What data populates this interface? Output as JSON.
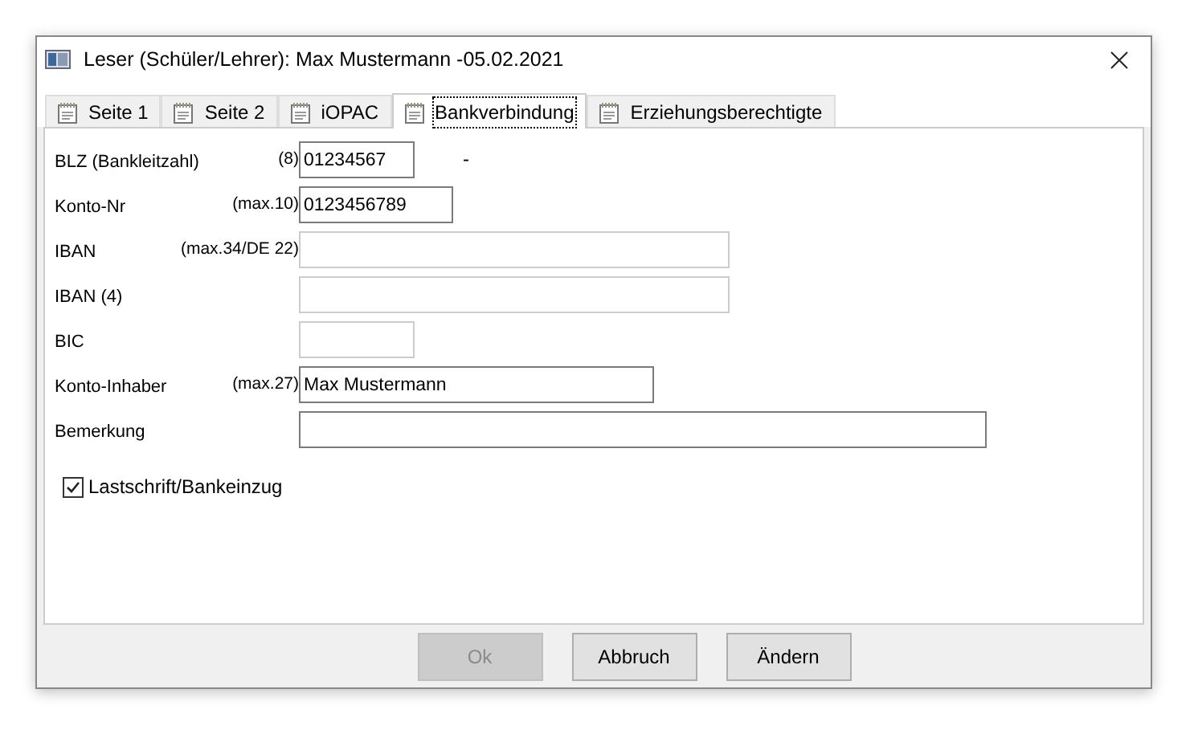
{
  "window": {
    "title": "Leser (Schüler/Lehrer): Max Mustermann -05.02.2021"
  },
  "tabs": [
    {
      "label": "Seite 1",
      "selected": false
    },
    {
      "label": "Seite 2",
      "selected": false
    },
    {
      "label": "iOPAC",
      "selected": false
    },
    {
      "label": "Bankverbindung",
      "selected": true
    },
    {
      "label": "Erziehungsberechtigte",
      "selected": false
    }
  ],
  "fields": [
    {
      "label": "BLZ (Bankleitzahl)",
      "hint": "(8)",
      "value": "01234567",
      "kind": "short",
      "disabled": false,
      "note": "-"
    },
    {
      "label": "Konto-Nr",
      "hint": "(max.10)",
      "value": "0123456789",
      "kind": "medium",
      "disabled": false
    },
    {
      "label": "IBAN",
      "hint": "(max.34/DE 22)",
      "kind": "long",
      "disabled": true
    },
    {
      "label": "IBAN (4)",
      "kind": "long",
      "disabled": true
    },
    {
      "label": "BIC",
      "kind": "short",
      "disabled": true
    },
    {
      "label": "Konto-Inhaber",
      "hint": "(max.27)",
      "value": "Max Mustermann",
      "kind": "wide",
      "disabled": false
    },
    {
      "label": "Bemerkung",
      "kind": "full",
      "disabled": false
    }
  ],
  "checkbox": {
    "label": "Lastschrift/Bankeinzug",
    "checked": true
  },
  "buttons": [
    {
      "label": "Ok",
      "disabled": true
    },
    {
      "label": "Abbruch",
      "disabled": false
    },
    {
      "label": "Ändern",
      "disabled": false
    }
  ]
}
